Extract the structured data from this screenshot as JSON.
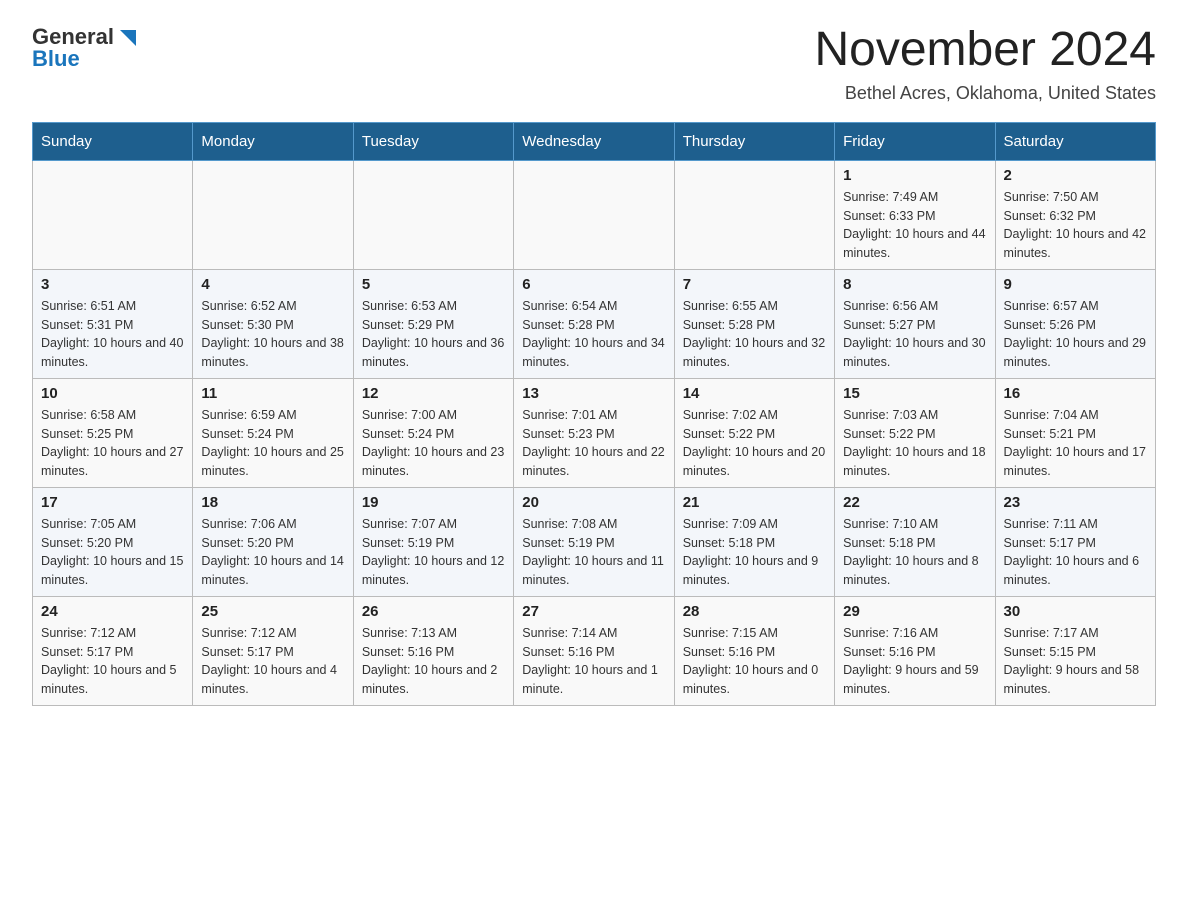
{
  "logo": {
    "text_general": "General",
    "text_blue": "Blue",
    "arrow": "▶"
  },
  "header": {
    "title": "November 2024",
    "subtitle": "Bethel Acres, Oklahoma, United States"
  },
  "days_of_week": [
    "Sunday",
    "Monday",
    "Tuesday",
    "Wednesday",
    "Thursday",
    "Friday",
    "Saturday"
  ],
  "weeks": [
    [
      {
        "day": "",
        "info": ""
      },
      {
        "day": "",
        "info": ""
      },
      {
        "day": "",
        "info": ""
      },
      {
        "day": "",
        "info": ""
      },
      {
        "day": "",
        "info": ""
      },
      {
        "day": "1",
        "info": "Sunrise: 7:49 AM\nSunset: 6:33 PM\nDaylight: 10 hours and 44 minutes."
      },
      {
        "day": "2",
        "info": "Sunrise: 7:50 AM\nSunset: 6:32 PM\nDaylight: 10 hours and 42 minutes."
      }
    ],
    [
      {
        "day": "3",
        "info": "Sunrise: 6:51 AM\nSunset: 5:31 PM\nDaylight: 10 hours and 40 minutes."
      },
      {
        "day": "4",
        "info": "Sunrise: 6:52 AM\nSunset: 5:30 PM\nDaylight: 10 hours and 38 minutes."
      },
      {
        "day": "5",
        "info": "Sunrise: 6:53 AM\nSunset: 5:29 PM\nDaylight: 10 hours and 36 minutes."
      },
      {
        "day": "6",
        "info": "Sunrise: 6:54 AM\nSunset: 5:28 PM\nDaylight: 10 hours and 34 minutes."
      },
      {
        "day": "7",
        "info": "Sunrise: 6:55 AM\nSunset: 5:28 PM\nDaylight: 10 hours and 32 minutes."
      },
      {
        "day": "8",
        "info": "Sunrise: 6:56 AM\nSunset: 5:27 PM\nDaylight: 10 hours and 30 minutes."
      },
      {
        "day": "9",
        "info": "Sunrise: 6:57 AM\nSunset: 5:26 PM\nDaylight: 10 hours and 29 minutes."
      }
    ],
    [
      {
        "day": "10",
        "info": "Sunrise: 6:58 AM\nSunset: 5:25 PM\nDaylight: 10 hours and 27 minutes."
      },
      {
        "day": "11",
        "info": "Sunrise: 6:59 AM\nSunset: 5:24 PM\nDaylight: 10 hours and 25 minutes."
      },
      {
        "day": "12",
        "info": "Sunrise: 7:00 AM\nSunset: 5:24 PM\nDaylight: 10 hours and 23 minutes."
      },
      {
        "day": "13",
        "info": "Sunrise: 7:01 AM\nSunset: 5:23 PM\nDaylight: 10 hours and 22 minutes."
      },
      {
        "day": "14",
        "info": "Sunrise: 7:02 AM\nSunset: 5:22 PM\nDaylight: 10 hours and 20 minutes."
      },
      {
        "day": "15",
        "info": "Sunrise: 7:03 AM\nSunset: 5:22 PM\nDaylight: 10 hours and 18 minutes."
      },
      {
        "day": "16",
        "info": "Sunrise: 7:04 AM\nSunset: 5:21 PM\nDaylight: 10 hours and 17 minutes."
      }
    ],
    [
      {
        "day": "17",
        "info": "Sunrise: 7:05 AM\nSunset: 5:20 PM\nDaylight: 10 hours and 15 minutes."
      },
      {
        "day": "18",
        "info": "Sunrise: 7:06 AM\nSunset: 5:20 PM\nDaylight: 10 hours and 14 minutes."
      },
      {
        "day": "19",
        "info": "Sunrise: 7:07 AM\nSunset: 5:19 PM\nDaylight: 10 hours and 12 minutes."
      },
      {
        "day": "20",
        "info": "Sunrise: 7:08 AM\nSunset: 5:19 PM\nDaylight: 10 hours and 11 minutes."
      },
      {
        "day": "21",
        "info": "Sunrise: 7:09 AM\nSunset: 5:18 PM\nDaylight: 10 hours and 9 minutes."
      },
      {
        "day": "22",
        "info": "Sunrise: 7:10 AM\nSunset: 5:18 PM\nDaylight: 10 hours and 8 minutes."
      },
      {
        "day": "23",
        "info": "Sunrise: 7:11 AM\nSunset: 5:17 PM\nDaylight: 10 hours and 6 minutes."
      }
    ],
    [
      {
        "day": "24",
        "info": "Sunrise: 7:12 AM\nSunset: 5:17 PM\nDaylight: 10 hours and 5 minutes."
      },
      {
        "day": "25",
        "info": "Sunrise: 7:12 AM\nSunset: 5:17 PM\nDaylight: 10 hours and 4 minutes."
      },
      {
        "day": "26",
        "info": "Sunrise: 7:13 AM\nSunset: 5:16 PM\nDaylight: 10 hours and 2 minutes."
      },
      {
        "day": "27",
        "info": "Sunrise: 7:14 AM\nSunset: 5:16 PM\nDaylight: 10 hours and 1 minute."
      },
      {
        "day": "28",
        "info": "Sunrise: 7:15 AM\nSunset: 5:16 PM\nDaylight: 10 hours and 0 minutes."
      },
      {
        "day": "29",
        "info": "Sunrise: 7:16 AM\nSunset: 5:16 PM\nDaylight: 9 hours and 59 minutes."
      },
      {
        "day": "30",
        "info": "Sunrise: 7:17 AM\nSunset: 5:15 PM\nDaylight: 9 hours and 58 minutes."
      }
    ]
  ]
}
